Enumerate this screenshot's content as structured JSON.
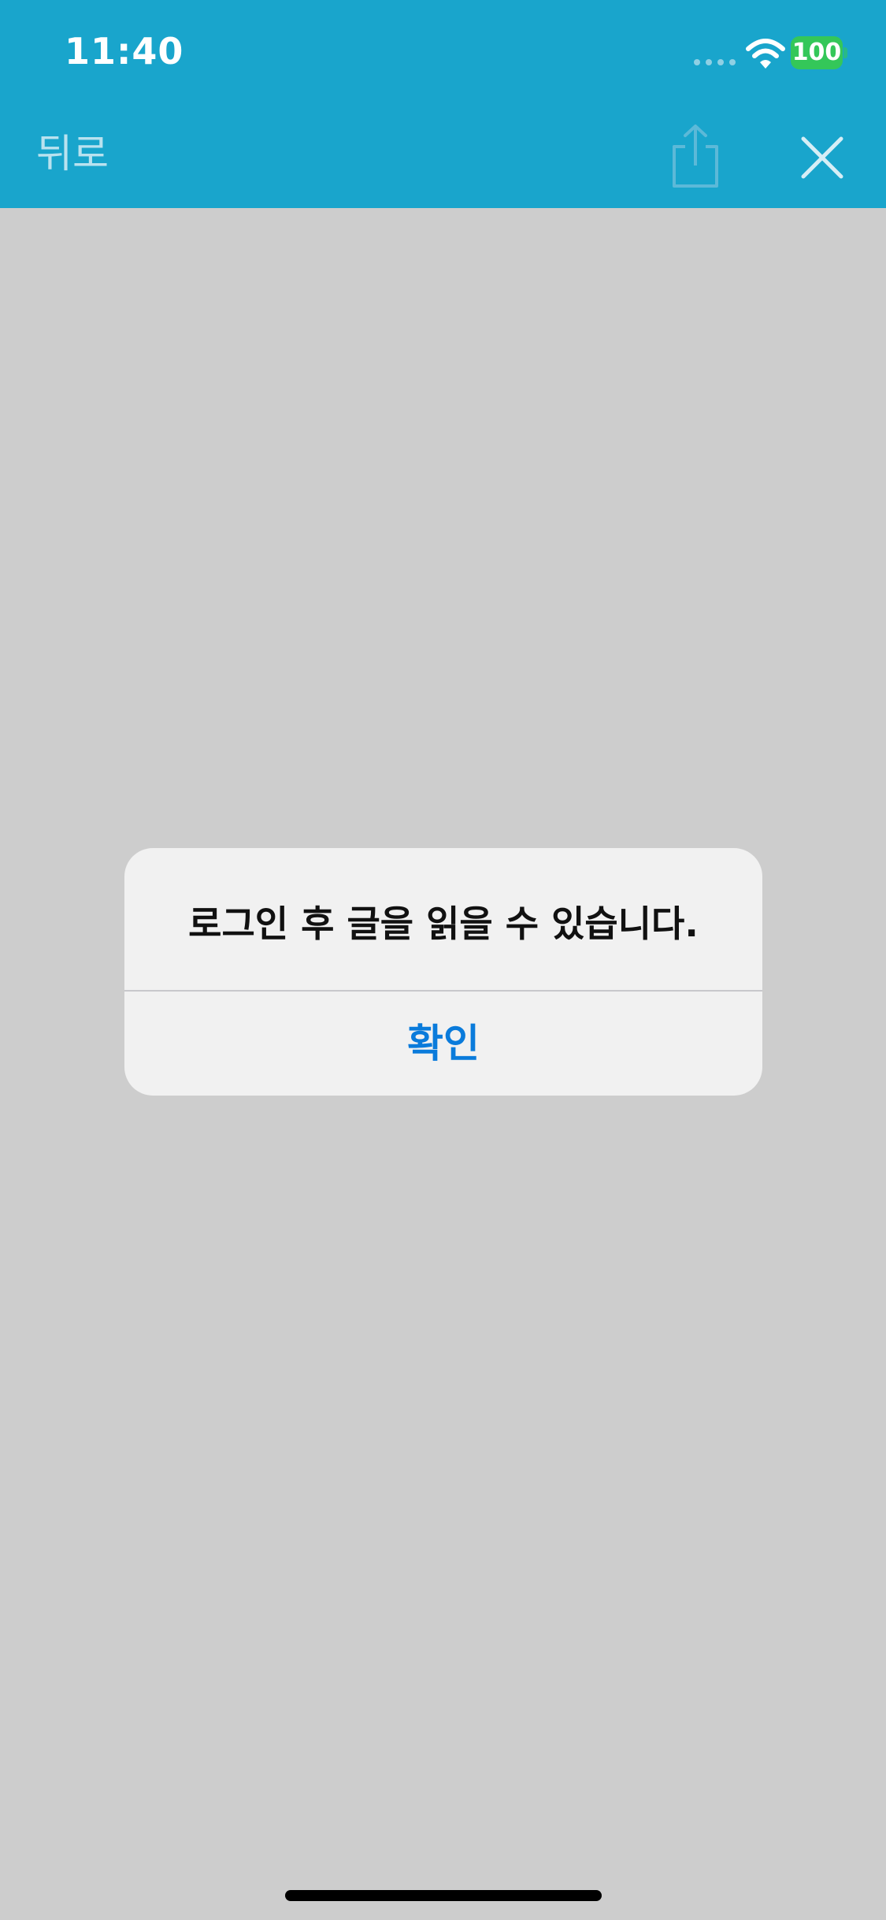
{
  "status_bar": {
    "time": "11:40",
    "battery_level": "100",
    "icons": [
      "signal-dots-icon",
      "wifi-icon",
      "battery-icon"
    ],
    "background": "#19a5cc",
    "battery_color": "#34c759"
  },
  "nav": {
    "back_label": "뒤로",
    "share_icon": "share-icon",
    "close_icon": "close-icon"
  },
  "alert": {
    "message": "로그인 후 글을 읽을 수 있습니다.",
    "confirm_label": "확인",
    "confirm_color": "#0a7bdb"
  }
}
